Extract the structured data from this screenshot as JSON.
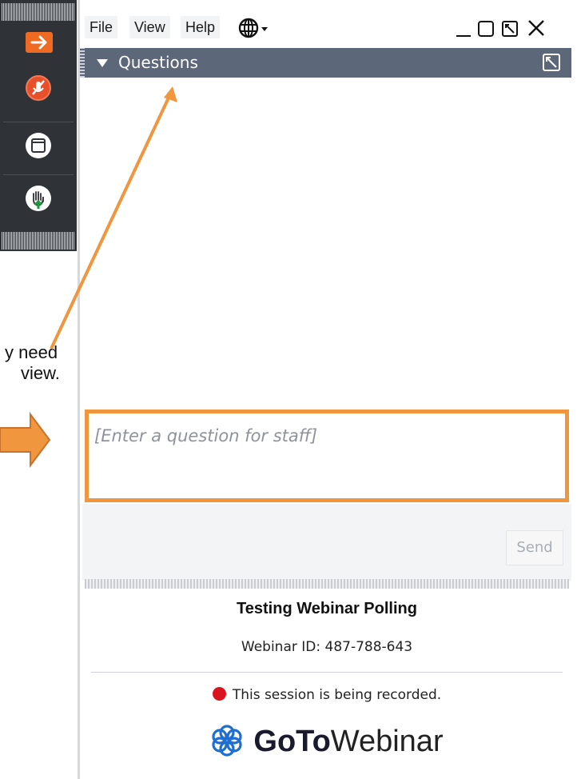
{
  "menu": {
    "file": "File",
    "view": "View",
    "help": "Help"
  },
  "panel": {
    "title": "Questions"
  },
  "question_input": {
    "placeholder": "[Enter a question for staff]"
  },
  "send_label": "Send",
  "webinar": {
    "title": "Testing Webinar Polling",
    "id_text": "Webinar ID: 487-788-643",
    "recording_text": "This session is being recorded.",
    "logo_bold": "GoTo",
    "logo_light": "Webinar"
  },
  "caption": {
    "line1": "y need",
    "line2": "view."
  },
  "colors": {
    "accent": "#f0963f",
    "toolbar": "#2f3237",
    "header": "#5c6779",
    "record": "#d9141f"
  },
  "icons": [
    "arrow-right-icon",
    "mic-muted-icon",
    "window-icon",
    "raise-hand-icon",
    "globe-icon",
    "minimize-icon",
    "maximize-icon",
    "popout-icon",
    "close-icon"
  ]
}
